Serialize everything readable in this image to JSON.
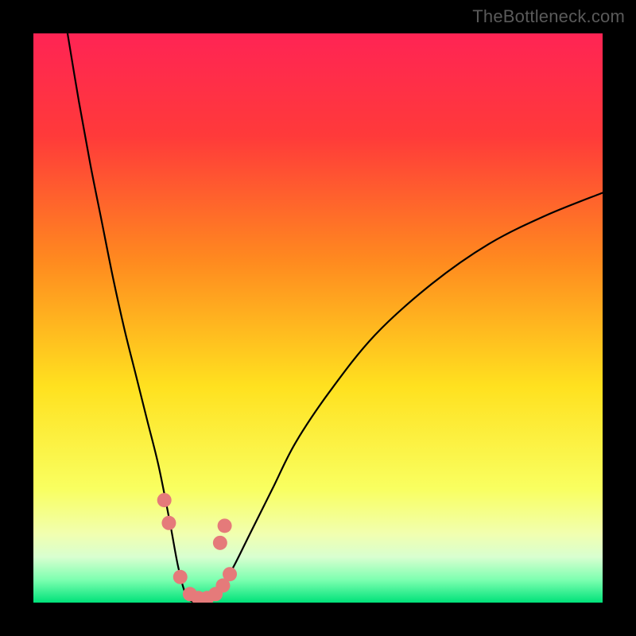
{
  "watermark": "TheBottleneck.com",
  "chart_data": {
    "type": "line",
    "title": "",
    "xlabel": "",
    "ylabel": "",
    "xlim": [
      0,
      100
    ],
    "ylim": [
      0,
      100
    ],
    "background_gradient_stops": [
      {
        "pct": 0,
        "color": "#ff2454"
      },
      {
        "pct": 18,
        "color": "#ff3a3a"
      },
      {
        "pct": 40,
        "color": "#ff8a1f"
      },
      {
        "pct": 62,
        "color": "#ffe11f"
      },
      {
        "pct": 80,
        "color": "#f9ff60"
      },
      {
        "pct": 88,
        "color": "#f1ffb0"
      },
      {
        "pct": 92,
        "color": "#d8ffd0"
      },
      {
        "pct": 96,
        "color": "#7dffb0"
      },
      {
        "pct": 100,
        "color": "#00e27a"
      }
    ],
    "series": [
      {
        "name": "bottleneck-curve",
        "color": "#000000",
        "x": [
          6,
          8,
          10,
          12,
          14,
          16,
          18,
          20,
          22,
          24,
          25.5,
          27,
          29,
          31,
          32.5,
          35,
          38,
          42,
          46,
          52,
          60,
          70,
          80,
          90,
          100
        ],
        "y": [
          100,
          88,
          77,
          67,
          57,
          48,
          40,
          32,
          24,
          14,
          6,
          1,
          0,
          0.5,
          2,
          6,
          12,
          20,
          28,
          37,
          47,
          56,
          63,
          68,
          72
        ]
      }
    ],
    "markers": {
      "name": "highlight-points",
      "color": "#e57a7a",
      "radius": 9,
      "points": [
        {
          "x": 23.0,
          "y": 18
        },
        {
          "x": 23.8,
          "y": 14
        },
        {
          "x": 25.8,
          "y": 4.5
        },
        {
          "x": 27.5,
          "y": 1.5
        },
        {
          "x": 29.0,
          "y": 0.8
        },
        {
          "x": 30.5,
          "y": 0.8
        },
        {
          "x": 32.0,
          "y": 1.5
        },
        {
          "x": 33.3,
          "y": 3.0
        },
        {
          "x": 34.5,
          "y": 5.0
        },
        {
          "x": 32.8,
          "y": 10.5
        },
        {
          "x": 33.6,
          "y": 13.5
        }
      ]
    }
  }
}
